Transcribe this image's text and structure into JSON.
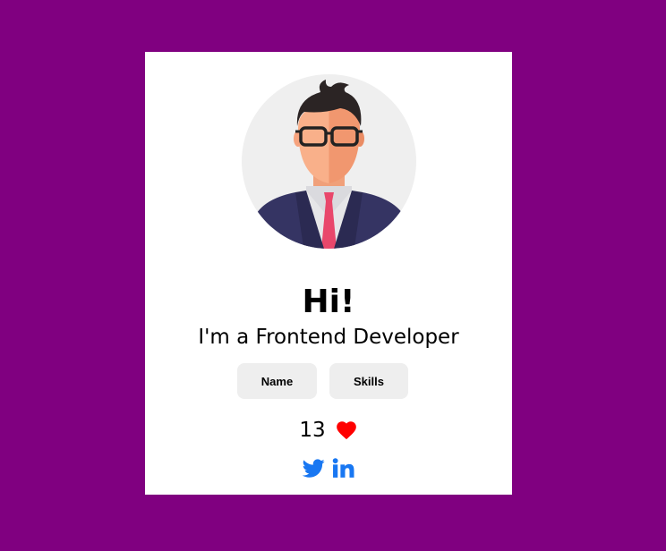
{
  "colors": {
    "background": "#800080",
    "card": "#ffffff",
    "button_bg": "#eeeeee",
    "heart": "#ff0000",
    "social": "#1877f2"
  },
  "profile": {
    "avatar_icon": "developer-avatar",
    "greeting": "Hi!",
    "role": "I'm a Frontend Developer"
  },
  "buttons": {
    "name_label": "Name",
    "skills_label": "Skills"
  },
  "likes": {
    "count": "13",
    "icon": "heart-icon"
  },
  "social": {
    "links": [
      {
        "icon": "twitter-icon"
      },
      {
        "icon": "linkedin-icon"
      }
    ]
  }
}
